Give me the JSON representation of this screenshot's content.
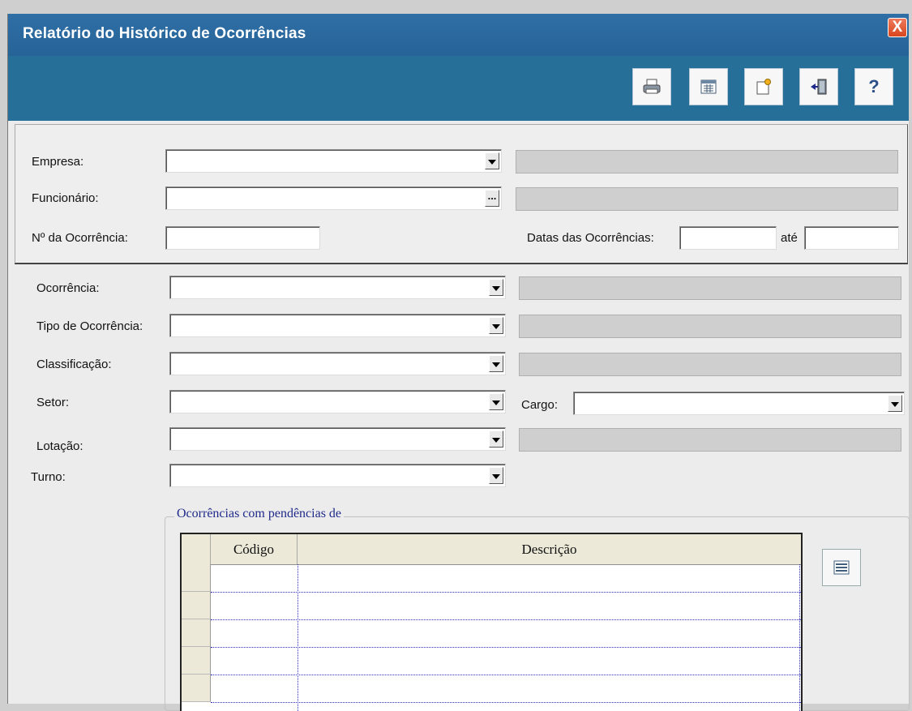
{
  "window": {
    "title": "Relatório do Histórico de Ocorrências",
    "close_label": "X"
  },
  "toolbar": {
    "buttons": [
      {
        "name": "print-button",
        "icon": "printer-icon"
      },
      {
        "name": "grid-button",
        "icon": "table-icon"
      },
      {
        "name": "note-button",
        "icon": "note-icon"
      },
      {
        "name": "exit-button",
        "icon": "exit-door-icon"
      },
      {
        "name": "help-button",
        "icon": "help-icon",
        "glyph": "?"
      }
    ]
  },
  "filters": {
    "empresa": {
      "label": "Empresa:",
      "value": "",
      "description": ""
    },
    "funcionario": {
      "label": "Funcionário:",
      "value": "",
      "description": "",
      "button": "..."
    },
    "num_ocorrencia": {
      "label": "Nº da Ocorrência:",
      "value": ""
    },
    "datas": {
      "label": "Datas das Ocorrências:",
      "from": "",
      "to_label": "até",
      "to": ""
    }
  },
  "criteria": {
    "ocorrencia": {
      "label": "Ocorrência:",
      "value": "",
      "description": ""
    },
    "tipo": {
      "label": "Tipo de Ocorrência:",
      "value": "",
      "description": ""
    },
    "classificacao": {
      "label": "Classificação:",
      "value": "",
      "description": ""
    },
    "setor": {
      "label": "Setor:",
      "value": ""
    },
    "cargo": {
      "label": "Cargo:",
      "value": ""
    },
    "lotacao": {
      "label": "Lotação:",
      "value": "",
      "description": ""
    },
    "turno": {
      "label": "Turno:",
      "value": ""
    }
  },
  "pendencias": {
    "legend": "Ocorrências com pendências de",
    "columns": [
      "Código",
      "Descrição"
    ],
    "rows": [
      {
        "codigo": "",
        "descricao": ""
      },
      {
        "codigo": "",
        "descricao": ""
      },
      {
        "codigo": "",
        "descricao": ""
      },
      {
        "codigo": "",
        "descricao": ""
      },
      {
        "codigo": "",
        "descricao": ""
      }
    ]
  },
  "colors": {
    "titlebar": "#2f6fa6",
    "toolbar": "#256f98",
    "legend": "#1f2a8a",
    "close": "#d7461e"
  }
}
